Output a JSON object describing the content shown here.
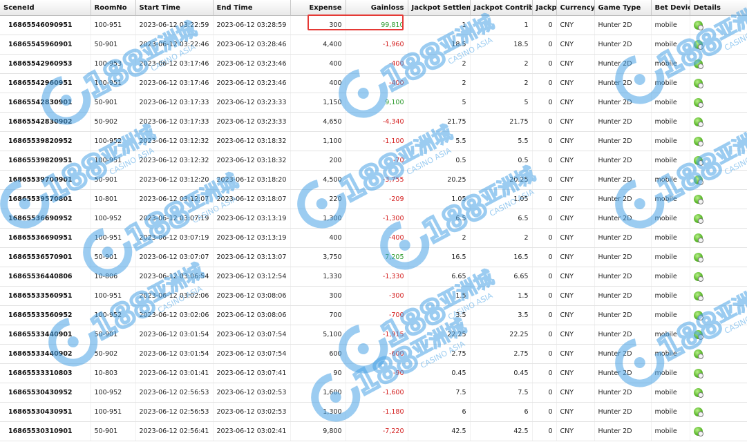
{
  "columns": [
    "SceneId",
    "RoomNo",
    "Start Time",
    "End Time",
    "Expense",
    "Gainloss",
    "Jackpot Settleme",
    "Jackpot Contribu",
    "Jackpo",
    "Currency",
    "Game Type",
    "Bet Devic",
    "Details"
  ],
  "watermark": {
    "logo_text": "188",
    "cn_text": "亚洲城",
    "sub_text": "CASINO ASIA"
  },
  "colors": {
    "negative": "#d42020",
    "positive": "#2c9a2c",
    "highlight": "#e53935"
  },
  "details_icon": "green-ok-icon",
  "highlight_row": 0,
  "rows": [
    {
      "scene": "16865546090951",
      "room": "100-951",
      "start": "2023-06-12 03:22:59",
      "end": "2023-06-12 03:28:59",
      "expense": "300",
      "gainloss": "99,810",
      "gl_sign": "pos",
      "jp_settle": "1",
      "jp_contrib": "1",
      "jackpot": "0",
      "currency": "CNY",
      "game": "Hunter 2D",
      "device": "mobile"
    },
    {
      "scene": "16865545960901",
      "room": "50-901",
      "start": "2023-06-12 03:22:46",
      "end": "2023-06-12 03:28:46",
      "expense": "4,400",
      "gainloss": "-1,960",
      "gl_sign": "neg",
      "jp_settle": "18.5",
      "jp_contrib": "18.5",
      "jackpot": "0",
      "currency": "CNY",
      "game": "Hunter 2D",
      "device": "mobile"
    },
    {
      "scene": "16865542960953",
      "room": "100-953",
      "start": "2023-06-12 03:17:46",
      "end": "2023-06-12 03:23:46",
      "expense": "400",
      "gainloss": "-400",
      "gl_sign": "neg",
      "jp_settle": "2",
      "jp_contrib": "2",
      "jackpot": "0",
      "currency": "CNY",
      "game": "Hunter 2D",
      "device": "mobile"
    },
    {
      "scene": "16865542960951",
      "room": "100-951",
      "start": "2023-06-12 03:17:46",
      "end": "2023-06-12 03:23:46",
      "expense": "400",
      "gainloss": "-400",
      "gl_sign": "neg",
      "jp_settle": "2",
      "jp_contrib": "2",
      "jackpot": "0",
      "currency": "CNY",
      "game": "Hunter 2D",
      "device": "mobile"
    },
    {
      "scene": "16865542830901",
      "room": "50-901",
      "start": "2023-06-12 03:17:33",
      "end": "2023-06-12 03:23:33",
      "expense": "1,150",
      "gainloss": "9,100",
      "gl_sign": "pos",
      "jp_settle": "5",
      "jp_contrib": "5",
      "jackpot": "0",
      "currency": "CNY",
      "game": "Hunter 2D",
      "device": "mobile"
    },
    {
      "scene": "16865542830902",
      "room": "50-902",
      "start": "2023-06-12 03:17:33",
      "end": "2023-06-12 03:23:33",
      "expense": "4,650",
      "gainloss": "-4,340",
      "gl_sign": "neg",
      "jp_settle": "21.75",
      "jp_contrib": "21.75",
      "jackpot": "0",
      "currency": "CNY",
      "game": "Hunter 2D",
      "device": "mobile"
    },
    {
      "scene": "16865539820952",
      "room": "100-952",
      "start": "2023-06-12 03:12:32",
      "end": "2023-06-12 03:18:32",
      "expense": "1,100",
      "gainloss": "-1,100",
      "gl_sign": "neg",
      "jp_settle": "5.5",
      "jp_contrib": "5.5",
      "jackpot": "0",
      "currency": "CNY",
      "game": "Hunter 2D",
      "device": "mobile"
    },
    {
      "scene": "16865539820951",
      "room": "100-951",
      "start": "2023-06-12 03:12:32",
      "end": "2023-06-12 03:18:32",
      "expense": "200",
      "gainloss": "-70",
      "gl_sign": "neg",
      "jp_settle": "0.5",
      "jp_contrib": "0.5",
      "jackpot": "0",
      "currency": "CNY",
      "game": "Hunter 2D",
      "device": "mobile"
    },
    {
      "scene": "16865539700901",
      "room": "50-901",
      "start": "2023-06-12 03:12:20",
      "end": "2023-06-12 03:18:20",
      "expense": "4,500",
      "gainloss": "-3,755",
      "gl_sign": "neg",
      "jp_settle": "20.25",
      "jp_contrib": "20.25",
      "jackpot": "0",
      "currency": "CNY",
      "game": "Hunter 2D",
      "device": "mobile"
    },
    {
      "scene": "16865539570801",
      "room": "10-801",
      "start": "2023-06-12 03:12:07",
      "end": "2023-06-12 03:18:07",
      "expense": "220",
      "gainloss": "-209",
      "gl_sign": "neg",
      "jp_settle": "1.05",
      "jp_contrib": "1.05",
      "jackpot": "0",
      "currency": "CNY",
      "game": "Hunter 2D",
      "device": "mobile"
    },
    {
      "scene": "16865536690952",
      "room": "100-952",
      "start": "2023-06-12 03:07:19",
      "end": "2023-06-12 03:13:19",
      "expense": "1,300",
      "gainloss": "-1,300",
      "gl_sign": "neg",
      "jp_settle": "6.5",
      "jp_contrib": "6.5",
      "jackpot": "0",
      "currency": "CNY",
      "game": "Hunter 2D",
      "device": "mobile"
    },
    {
      "scene": "16865536690951",
      "room": "100-951",
      "start": "2023-06-12 03:07:19",
      "end": "2023-06-12 03:13:19",
      "expense": "400",
      "gainloss": "-400",
      "gl_sign": "neg",
      "jp_settle": "2",
      "jp_contrib": "2",
      "jackpot": "0",
      "currency": "CNY",
      "game": "Hunter 2D",
      "device": "mobile"
    },
    {
      "scene": "16865536570901",
      "room": "50-901",
      "start": "2023-06-12 03:07:07",
      "end": "2023-06-12 03:13:07",
      "expense": "3,750",
      "gainloss": "7,205",
      "gl_sign": "pos",
      "jp_settle": "16.5",
      "jp_contrib": "16.5",
      "jackpot": "0",
      "currency": "CNY",
      "game": "Hunter 2D",
      "device": "mobile"
    },
    {
      "scene": "16865536440806",
      "room": "10-806",
      "start": "2023-06-12 03:06:54",
      "end": "2023-06-12 03:12:54",
      "expense": "1,330",
      "gainloss": "-1,330",
      "gl_sign": "neg",
      "jp_settle": "6.65",
      "jp_contrib": "6.65",
      "jackpot": "0",
      "currency": "CNY",
      "game": "Hunter 2D",
      "device": "mobile"
    },
    {
      "scene": "16865533560951",
      "room": "100-951",
      "start": "2023-06-12 03:02:06",
      "end": "2023-06-12 03:08:06",
      "expense": "300",
      "gainloss": "-300",
      "gl_sign": "neg",
      "jp_settle": "1.5",
      "jp_contrib": "1.5",
      "jackpot": "0",
      "currency": "CNY",
      "game": "Hunter 2D",
      "device": "mobile"
    },
    {
      "scene": "16865533560952",
      "room": "100-952",
      "start": "2023-06-12 03:02:06",
      "end": "2023-06-12 03:08:06",
      "expense": "700",
      "gainloss": "-700",
      "gl_sign": "neg",
      "jp_settle": "3.5",
      "jp_contrib": "3.5",
      "jackpot": "0",
      "currency": "CNY",
      "game": "Hunter 2D",
      "device": "mobile"
    },
    {
      "scene": "16865533440901",
      "room": "50-901",
      "start": "2023-06-12 03:01:54",
      "end": "2023-06-12 03:07:54",
      "expense": "5,100",
      "gainloss": "-1,915",
      "gl_sign": "neg",
      "jp_settle": "22.25",
      "jp_contrib": "22.25",
      "jackpot": "0",
      "currency": "CNY",
      "game": "Hunter 2D",
      "device": "mobile"
    },
    {
      "scene": "16865533440902",
      "room": "50-902",
      "start": "2023-06-12 03:01:54",
      "end": "2023-06-12 03:07:54",
      "expense": "600",
      "gainloss": "-600",
      "gl_sign": "neg",
      "jp_settle": "2.75",
      "jp_contrib": "2.75",
      "jackpot": "0",
      "currency": "CNY",
      "game": "Hunter 2D",
      "device": "mobile"
    },
    {
      "scene": "16865533310803",
      "room": "10-803",
      "start": "2023-06-12 03:01:41",
      "end": "2023-06-12 03:07:41",
      "expense": "90",
      "gainloss": "-90",
      "gl_sign": "neg",
      "jp_settle": "0.45",
      "jp_contrib": "0.45",
      "jackpot": "0",
      "currency": "CNY",
      "game": "Hunter 2D",
      "device": "mobile"
    },
    {
      "scene": "16865530430952",
      "room": "100-952",
      "start": "2023-06-12 02:56:53",
      "end": "2023-06-12 03:02:53",
      "expense": "1,600",
      "gainloss": "-1,600",
      "gl_sign": "neg",
      "jp_settle": "7.5",
      "jp_contrib": "7.5",
      "jackpot": "0",
      "currency": "CNY",
      "game": "Hunter 2D",
      "device": "mobile"
    },
    {
      "scene": "16865530430951",
      "room": "100-951",
      "start": "2023-06-12 02:56:53",
      "end": "2023-06-12 03:02:53",
      "expense": "1,300",
      "gainloss": "-1,180",
      "gl_sign": "neg",
      "jp_settle": "6",
      "jp_contrib": "6",
      "jackpot": "0",
      "currency": "CNY",
      "game": "Hunter 2D",
      "device": "mobile"
    },
    {
      "scene": "16865530310901",
      "room": "50-901",
      "start": "2023-06-12 02:56:41",
      "end": "2023-06-12 03:02:41",
      "expense": "9,800",
      "gainloss": "-7,220",
      "gl_sign": "neg",
      "jp_settle": "42.5",
      "jp_contrib": "42.5",
      "jackpot": "0",
      "currency": "CNY",
      "game": "Hunter 2D",
      "device": "mobile"
    }
  ]
}
